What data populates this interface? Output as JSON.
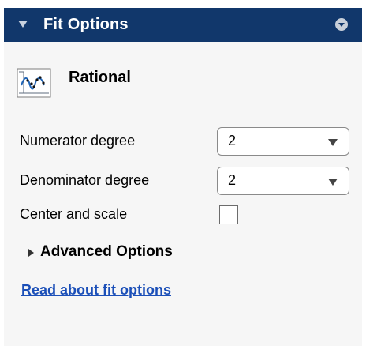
{
  "panel": {
    "title": "Fit Options",
    "collapse_icon": "triangle-down",
    "menu_icon": "circle-chevron-down"
  },
  "fit_type": {
    "icon": "rational-fit-icon",
    "label": "Rational"
  },
  "numerator": {
    "label": "Numerator degree",
    "value": "2"
  },
  "denominator": {
    "label": "Denominator degree",
    "value": "2"
  },
  "center_scale": {
    "label": "Center and scale",
    "checked": false
  },
  "advanced": {
    "label": "Advanced Options",
    "expanded": false
  },
  "help": {
    "link_text": "Read about fit options"
  },
  "colors": {
    "header_bg": "#11376b",
    "panel_bg": "#f6f6f6",
    "link": "#1b4fb8"
  }
}
